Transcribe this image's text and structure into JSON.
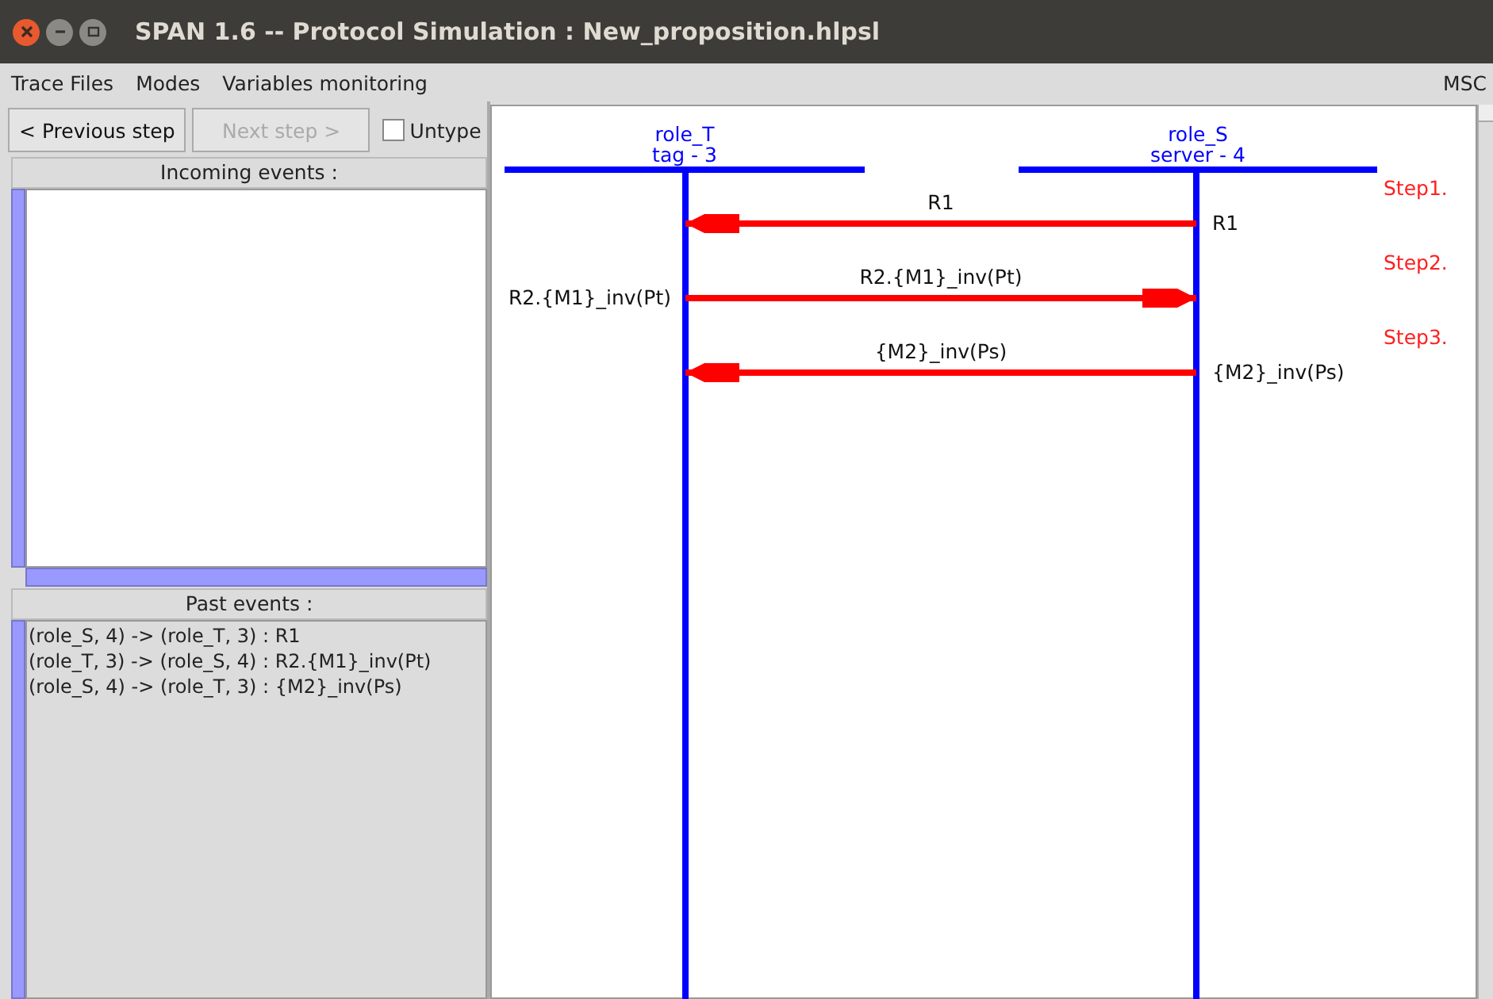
{
  "window": {
    "title": "SPAN 1.6 -- Protocol Simulation : New_proposition.hlpsl"
  },
  "menu": [
    "Trace Files",
    "Modes",
    "Variables monitoring"
  ],
  "menu_right": "MSC",
  "toolbar": {
    "previous": {
      "label": "< Previous step",
      "disabled": false
    },
    "next": {
      "label": "Next step >",
      "disabled": true
    },
    "untype": {
      "label": "Untype",
      "checked": false
    }
  },
  "incoming_events": {
    "title": "Incoming events :"
  },
  "past_events": {
    "title": "Past events :",
    "items": [
      "(role_S, 4) -> (role_T, 3) : R1",
      "(role_T, 3) -> (role_S, 4) : R2.{M1}_inv(Pt)",
      "(role_S, 4) -> (role_T, 3) : {M2}_inv(Ps)"
    ]
  },
  "diagram": {
    "roles": [
      {
        "name": "role_T",
        "instance": "tag - 3"
      },
      {
        "name": "role_S",
        "instance": "server - 4"
      }
    ],
    "messages": [
      {
        "step": "Step1.",
        "label": "R1",
        "kind": "leftward",
        "sender_label": "R1"
      },
      {
        "step": "Step2.",
        "label": "R2.{M1}_inv(Pt)",
        "kind": "rightward",
        "sender_label": "R2.{M1}_inv(Pt)"
      },
      {
        "step": "Step3.",
        "label": "{M2}_inv(Ps)",
        "kind": "leftward",
        "sender_label": "{M2}_inv(Ps)"
      }
    ]
  }
}
